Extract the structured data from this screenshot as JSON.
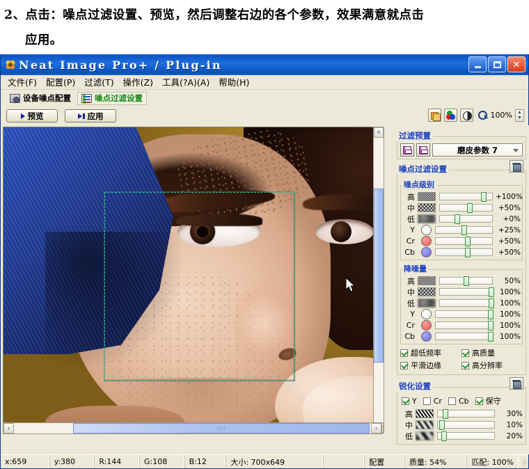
{
  "caption": {
    "line1": "2、点击：噪点过滤设置、预览，然后调整右边的各个参数，效果满意就点击",
    "line2": "应用。"
  },
  "window": {
    "title": "Neat Image Pro+ / Plug-in",
    "icon": "flower-icon",
    "minimize_label": "",
    "maximize_label": "",
    "close_label": "✕"
  },
  "menu": {
    "items": [
      {
        "label": "文件(F)"
      },
      {
        "label": "配置(P)"
      },
      {
        "label": "过滤(T)"
      },
      {
        "label": "操作(Z)"
      },
      {
        "label": "工具(?A)(A)"
      },
      {
        "label": "帮助(H)"
      }
    ]
  },
  "tabs": [
    {
      "label": "设备噪点配置",
      "icon": "camera-icon",
      "active": false
    },
    {
      "label": "噪点过滤设置",
      "icon": "sliders-icon",
      "active": true
    }
  ],
  "toolbar": {
    "preview_label": "预览",
    "apply_label": "应用",
    "layers_icon": "layers-icon",
    "rgb_icon": "rgb-channels-icon",
    "contrast_icon": "contrast-icon",
    "zoom_icon": "magnifier-icon",
    "zoom_value": "100%",
    "spinner_up": "▲",
    "spinner_down": "▼"
  },
  "panel": {
    "preset": {
      "title": "过滤预置",
      "save_icon": "save-preset-icon",
      "saveas_icon": "save-as-preset-icon",
      "selected": "磨皮参数 7",
      "dropdown_icon": "chevron-down-icon"
    },
    "noise_filter": {
      "title": "噪点过滤设置",
      "trash_icon": "trash-icon",
      "noise_levels": {
        "title": "噪点级别",
        "rows": [
          {
            "label": "高",
            "swatch": "noise-high-swatch",
            "value": "+100%",
            "pos": 78
          },
          {
            "label": "中",
            "swatch": "noise-mid-swatch",
            "value": "+50%",
            "pos": 52
          },
          {
            "label": "低",
            "swatch": "noise-low-swatch",
            "value": "+0%",
            "pos": 28
          },
          {
            "label": "Y",
            "swatch": "channel-y-dot",
            "value": "+25%",
            "pos": 46
          },
          {
            "label": "Cr",
            "swatch": "channel-cr-dot",
            "value": "+50%",
            "pos": 52
          },
          {
            "label": "Cb",
            "swatch": "channel-cb-dot",
            "value": "+50%",
            "pos": 52
          }
        ]
      },
      "amounts": {
        "title": "降噪量",
        "rows": [
          {
            "label": "高",
            "swatch": "noise-high-swatch",
            "value": "50%",
            "pos": 45
          },
          {
            "label": "中",
            "swatch": "noise-mid-swatch",
            "value": "100%",
            "pos": 93
          },
          {
            "label": "低",
            "swatch": "noise-low-swatch",
            "value": "100%",
            "pos": 93
          },
          {
            "label": "Y",
            "swatch": "channel-y-dot",
            "value": "100%",
            "pos": 93
          },
          {
            "label": "Cr",
            "swatch": "channel-cr-dot",
            "value": "100%",
            "pos": 93
          },
          {
            "label": "Cb",
            "swatch": "channel-cb-dot",
            "value": "100%",
            "pos": 93
          }
        ]
      },
      "options": [
        {
          "label": "超低频率",
          "checked": true
        },
        {
          "label": "高质量",
          "checked": true
        },
        {
          "label": "平滑边缘",
          "checked": true
        },
        {
          "label": "高分辨率",
          "checked": true
        }
      ]
    },
    "sharpening": {
      "title": "锐化设置",
      "trash_icon": "trash-icon",
      "channels": [
        {
          "label": "Y",
          "checked": true
        },
        {
          "label": "Cr",
          "checked": false
        },
        {
          "label": "Cb",
          "checked": false
        },
        {
          "label": "保守",
          "checked": true
        }
      ],
      "rows": [
        {
          "label": "高",
          "swatch": "sharpen-high-swatch",
          "value": "30%",
          "pos": 9
        },
        {
          "label": "中",
          "swatch": "sharpen-mid-swatch",
          "value": "10%",
          "pos": 3
        },
        {
          "label": "低",
          "swatch": "sharpen-low-swatch",
          "value": "20%",
          "pos": 6
        }
      ]
    }
  },
  "image": {
    "hscroll_icons": {
      "left": "‹",
      "right": "›"
    },
    "vscroll_icons": {
      "up": "˄",
      "down": "˅"
    },
    "cursor_icon": "mouse-pointer-icon",
    "marquee_name": "preview-selection-rectangle"
  },
  "status": {
    "cells": [
      {
        "text": "x:659"
      },
      {
        "text": "y:380"
      },
      {
        "text": "R:144"
      },
      {
        "text": "G:108"
      },
      {
        "text": "B:12"
      },
      {
        "text": "大小: 700x649"
      },
      {
        "text": ""
      },
      {
        "text": "配置"
      },
      {
        "text": "质量: 54%"
      },
      {
        "text": "匹配: 100%"
      }
    ]
  },
  "colors": {
    "titlebar_blue": "#0c55c6",
    "panel_bg": "#ece9d8",
    "group_title": "#1a3fbf",
    "active_tab_label": "#1a8a1a",
    "checkbox_check": "#1d8f1d",
    "slider_knob": "#3d8f3d",
    "marquee": "#16c79a"
  }
}
